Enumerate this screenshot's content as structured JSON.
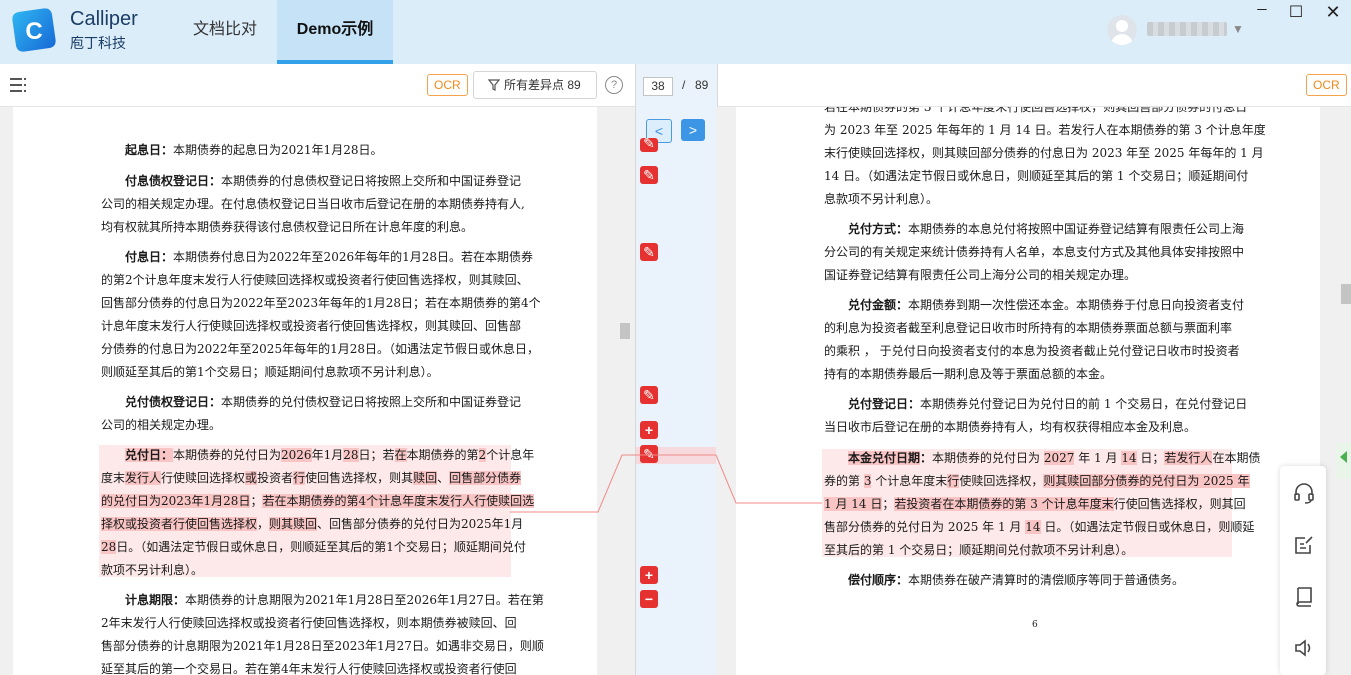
{
  "app": {
    "brand_en": "Calliper",
    "brand_cn": "庖丁科技",
    "tabs": [
      {
        "label": "文档比对",
        "active": false
      },
      {
        "label": "Demo示例",
        "active": true
      }
    ],
    "accent_color": "#33a0ea"
  },
  "toolbar": {
    "ocr_label": "OCR",
    "diff_filter_label": "所有差异点 89",
    "help_glyph": "?",
    "page_current": "38",
    "page_sep": "/",
    "page_total": "89",
    "prev_glyph": "<",
    "next_glyph": ">"
  },
  "markers": [
    {
      "type": "edit",
      "glyph": "✎"
    },
    {
      "type": "edit",
      "glyph": "✎"
    },
    {
      "type": "edit",
      "glyph": "✎"
    },
    {
      "type": "edit",
      "glyph": "✎"
    },
    {
      "type": "add",
      "glyph": "+"
    },
    {
      "type": "edit",
      "glyph": "✎",
      "active": true
    },
    {
      "type": "add",
      "glyph": "+"
    },
    {
      "type": "remove",
      "glyph": "−"
    }
  ],
  "left_doc": {
    "p1": {
      "label": "起息日：",
      "text": "本期债券的起息日为2021年1月28日。"
    },
    "p2": {
      "label": "付息债权登记日：",
      "l1": "本期债券的付息债权登记日将按照上交所和中国证券登记",
      "l2": "公司的相关规定办理。在付息债权登记日当日收市后登记在册的本期债券持有人,",
      "l3": "均有权就其所持本期债券获得该付息债权登记日所在计息年度的利息。"
    },
    "p3": {
      "label": "付息日：",
      "l1": "本期债券付息日为2022年至2026年每年的1月28日。若在本期债券",
      "l2": "的第2个计息年度末发行人行使赎回选择权或投资者行使回售选择权，则其赎回、",
      "l3": "回售部分债券的付息日为2022年至2023年每年的1月28日；若在本期债券的第4个",
      "l4": "计息年度末发行人行使赎回选择权或投资者行使回售选择权，则其赎回、回售部",
      "l5": "分债券的付息日为2022年至2025年每年的1月28日。（如遇法定节假日或休息日，",
      "l6": "则顺延至其后的第1个交易日；顺延期间付息款项不另计利息）。"
    },
    "p4": {
      "label": "兑付债权登记日：",
      "l1": "本期债券的兑付债权登记日将按照上交所和中国证券登记",
      "l2": "公司的相关规定办理。"
    },
    "p5": {
      "label": "兑付日：",
      "l1": [
        "本期债券的兑付日为",
        "2026",
        "年1月",
        "28",
        "日；若",
        "在",
        "本期债券的第",
        "2",
        "个计息年"
      ],
      "l2": [
        "度末",
        "发行人",
        "行使赎回选择权",
        "或",
        "投资者",
        "行",
        "使回售选择权，则其",
        "赎回",
        "、",
        "回售部分债券"
      ],
      "l3": [
        "的兑付日为2023年1月28日",
        "；",
        "若在本期债券的第4个计息年度末发行人行使赎回选"
      ],
      "l4": [
        "择权或投资者行使回售选择权",
        "，",
        "则其赎回",
        "、回售部分债券的兑付日为2025年1月"
      ],
      "l5": [
        "28",
        "日。（如遇法定节假日或休息日，则顺延至其后的第1个交易日；顺延期间兑付"
      ],
      "l6": "款项不另计利息）。"
    },
    "p6": {
      "label": "计息期限：",
      "l1": "本期债券的计息期限为2021年1月28日至2026年1月27日。若在第",
      "l2": "2年末发行人行使赎回选择权或投资者行使回售选择权，则本期债券被赎回、回",
      "l3": "售部分债券的计息期限为2021年1月28日至2023年1月27日。如遇非交易日，则顺",
      "l4": "延至其后的第一个交易日。若在第4年末发行人行使赎回选择权或投资者行使回"
    }
  },
  "right_doc": {
    "top": {
      "l1": "若在本期债券的第 3 个计息年度末行使回售选择权，则其回售部分债券的付息日",
      "l2": "为 2023 年至 2025 年每年的 1 月 14 日。若发行人在本期债券的第 3 个计息年度",
      "l3": "末行使赎回选择权，则其赎回部分债券的付息日为 2023 年至 2025 年每年的 1 月",
      "l4": "14 日。（如遇法定节假日或休息日，则顺延至其后的第 1 个交易日；顺延期间付",
      "l5": "息款项不另计利息）。"
    },
    "p1": {
      "label": "兑付方式：",
      "l1": "本期债券的本息兑付将按照中国证券登记结算有限责任公司上海",
      "l2": "分公司的有关规定来统计债券持有人名单，本息支付方式及其他具体安排按照中",
      "l3": "国证券登记结算有限责任公司上海分公司的相关规定办理。"
    },
    "p2": {
      "label": "兑付金额：",
      "l1": "本期债券到期一次性偿还本金。本期债券于付息日向投资者支付",
      "l2": "的利息为投资者截至利息登记日收市时所持有的本期债券票面总额与票面利率",
      "l3": "的乘积 ， 于兑付日向投资者支付的本息为投资者截止兑付登记日收市时投资者",
      "l4": "持有的本期债券最后一期利息及等于票面总额的本金。"
    },
    "p3": {
      "label": "兑付登记日：",
      "l1": "本期债券兑付登记日为兑付日的前 1 个交易日，在兑付登记日",
      "l2": "当日收市后登记在册的本期债券持有人，均有权获得相应本金及利息。"
    },
    "p4": {
      "label": "本金兑付日期",
      "colon": "：",
      "l1": [
        "本期债券的兑付日为 ",
        "2027",
        " 年 1 月 ",
        "14",
        " 日；",
        "若发行人",
        "在本期债"
      ],
      "l2": [
        "券的第 ",
        "3",
        " 个计息年度末",
        "行",
        "使赎回选择权，",
        "则其赎回部分债券的兑付日为 2025 年"
      ],
      "l3": [
        "1 月 14 日",
        "；",
        "若",
        "投资者在本期债券的第 3 个计息年度末",
        "行使回售选择权，则其回"
      ],
      "l4": [
        "售部分债券的兑付日为 2025 年 1 月 ",
        "14",
        " 日。（如遇法定节假日或休息日，则顺延"
      ],
      "l5": "至其后的第 1 个交易日；顺延期间兑付款项不另计利息）。"
    },
    "p5": {
      "label": "偿付顺序：",
      "text": "本期债券在破产清算时的清偿顺序等同于普通债务。"
    },
    "page_number": "6"
  }
}
